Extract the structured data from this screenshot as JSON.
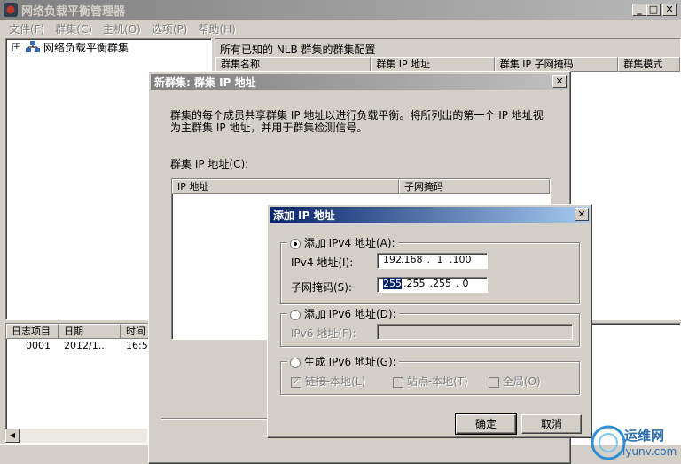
{
  "app": {
    "title": "网络负载平衡管理器",
    "menu": [
      "文件(F)",
      "群集(C)",
      "主机(O)",
      "选项(P)",
      "帮助(H)"
    ],
    "controls": {
      "minimize": "_",
      "maximize": "□",
      "close": "✕"
    }
  },
  "tree": {
    "root_label": "网络负载平衡群集",
    "expand_glyph": "+"
  },
  "right_panel": {
    "title": "所有已知的 NLB 群集的群集配置",
    "columns": [
      "群集名称",
      "群集 IP 地址",
      "群集 IP 子网掩码",
      "群集模式"
    ]
  },
  "log": {
    "columns": [
      "日志项目",
      "日期",
      "时间"
    ],
    "rows": [
      {
        "item": "0001",
        "date": "2012/1...",
        "time": "16:5"
      }
    ]
  },
  "cluster_dialog": {
    "title": "新群集:  群集 IP 地址",
    "description": "群集的每个成员共享群集 IP 地址以进行负载平衡。将所列出的第一个 IP 地址视为主群集 IP 地址，并用于群集检测信号。",
    "list_label": "群集 IP 地址(C):",
    "columns": [
      "IP 地址",
      "子网掩码"
    ]
  },
  "add_dialog": {
    "title": "添加 IP 地址",
    "ipv4_option": "添加 IPv4 地址(A):",
    "ipv4_label": "IPv4 地址(I):",
    "ipv4_octets": [
      "192",
      "168",
      "1",
      "100"
    ],
    "mask_label": "子网掩码(S):",
    "mask_octets": [
      "255",
      "255",
      "255",
      "0"
    ],
    "ipv6_option": "添加 IPv6 地址(D):",
    "ipv6_label": "IPv6 地址(F):",
    "gen_option": "生成 IPv6 地址(G):",
    "link_local": "链接-本地(L)",
    "site_local": "站点-本地(T)",
    "global": "全局(O)",
    "ok": "确定",
    "cancel": "取消",
    "close": "✕",
    "dot": "."
  },
  "watermark": {
    "text": "运维网",
    "url_text": "iyunv.com"
  },
  "colors": {
    "active_title": "#0a246a",
    "face": "#d4d0c8",
    "selection": "#0a246a"
  }
}
